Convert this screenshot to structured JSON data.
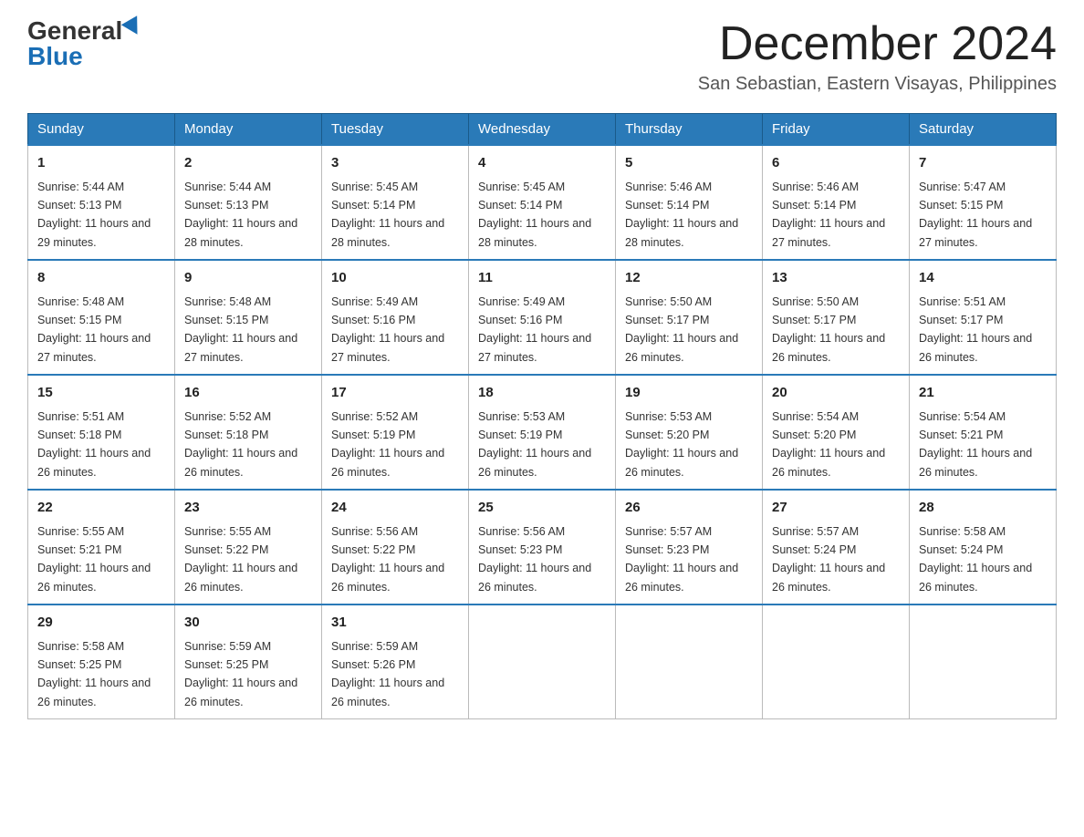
{
  "logo": {
    "general": "General",
    "blue": "Blue"
  },
  "title": {
    "month_year": "December 2024",
    "location": "San Sebastian, Eastern Visayas, Philippines"
  },
  "weekdays": [
    "Sunday",
    "Monday",
    "Tuesday",
    "Wednesday",
    "Thursday",
    "Friday",
    "Saturday"
  ],
  "weeks": [
    [
      {
        "day": "1",
        "sunrise": "5:44 AM",
        "sunset": "5:13 PM",
        "daylight": "11 hours and 29 minutes."
      },
      {
        "day": "2",
        "sunrise": "5:44 AM",
        "sunset": "5:13 PM",
        "daylight": "11 hours and 28 minutes."
      },
      {
        "day": "3",
        "sunrise": "5:45 AM",
        "sunset": "5:14 PM",
        "daylight": "11 hours and 28 minutes."
      },
      {
        "day": "4",
        "sunrise": "5:45 AM",
        "sunset": "5:14 PM",
        "daylight": "11 hours and 28 minutes."
      },
      {
        "day": "5",
        "sunrise": "5:46 AM",
        "sunset": "5:14 PM",
        "daylight": "11 hours and 28 minutes."
      },
      {
        "day": "6",
        "sunrise": "5:46 AM",
        "sunset": "5:14 PM",
        "daylight": "11 hours and 27 minutes."
      },
      {
        "day": "7",
        "sunrise": "5:47 AM",
        "sunset": "5:15 PM",
        "daylight": "11 hours and 27 minutes."
      }
    ],
    [
      {
        "day": "8",
        "sunrise": "5:48 AM",
        "sunset": "5:15 PM",
        "daylight": "11 hours and 27 minutes."
      },
      {
        "day": "9",
        "sunrise": "5:48 AM",
        "sunset": "5:15 PM",
        "daylight": "11 hours and 27 minutes."
      },
      {
        "day": "10",
        "sunrise": "5:49 AM",
        "sunset": "5:16 PM",
        "daylight": "11 hours and 27 minutes."
      },
      {
        "day": "11",
        "sunrise": "5:49 AM",
        "sunset": "5:16 PM",
        "daylight": "11 hours and 27 minutes."
      },
      {
        "day": "12",
        "sunrise": "5:50 AM",
        "sunset": "5:17 PM",
        "daylight": "11 hours and 26 minutes."
      },
      {
        "day": "13",
        "sunrise": "5:50 AM",
        "sunset": "5:17 PM",
        "daylight": "11 hours and 26 minutes."
      },
      {
        "day": "14",
        "sunrise": "5:51 AM",
        "sunset": "5:17 PM",
        "daylight": "11 hours and 26 minutes."
      }
    ],
    [
      {
        "day": "15",
        "sunrise": "5:51 AM",
        "sunset": "5:18 PM",
        "daylight": "11 hours and 26 minutes."
      },
      {
        "day": "16",
        "sunrise": "5:52 AM",
        "sunset": "5:18 PM",
        "daylight": "11 hours and 26 minutes."
      },
      {
        "day": "17",
        "sunrise": "5:52 AM",
        "sunset": "5:19 PM",
        "daylight": "11 hours and 26 minutes."
      },
      {
        "day": "18",
        "sunrise": "5:53 AM",
        "sunset": "5:19 PM",
        "daylight": "11 hours and 26 minutes."
      },
      {
        "day": "19",
        "sunrise": "5:53 AM",
        "sunset": "5:20 PM",
        "daylight": "11 hours and 26 minutes."
      },
      {
        "day": "20",
        "sunrise": "5:54 AM",
        "sunset": "5:20 PM",
        "daylight": "11 hours and 26 minutes."
      },
      {
        "day": "21",
        "sunrise": "5:54 AM",
        "sunset": "5:21 PM",
        "daylight": "11 hours and 26 minutes."
      }
    ],
    [
      {
        "day": "22",
        "sunrise": "5:55 AM",
        "sunset": "5:21 PM",
        "daylight": "11 hours and 26 minutes."
      },
      {
        "day": "23",
        "sunrise": "5:55 AM",
        "sunset": "5:22 PM",
        "daylight": "11 hours and 26 minutes."
      },
      {
        "day": "24",
        "sunrise": "5:56 AM",
        "sunset": "5:22 PM",
        "daylight": "11 hours and 26 minutes."
      },
      {
        "day": "25",
        "sunrise": "5:56 AM",
        "sunset": "5:23 PM",
        "daylight": "11 hours and 26 minutes."
      },
      {
        "day": "26",
        "sunrise": "5:57 AM",
        "sunset": "5:23 PM",
        "daylight": "11 hours and 26 minutes."
      },
      {
        "day": "27",
        "sunrise": "5:57 AM",
        "sunset": "5:24 PM",
        "daylight": "11 hours and 26 minutes."
      },
      {
        "day": "28",
        "sunrise": "5:58 AM",
        "sunset": "5:24 PM",
        "daylight": "11 hours and 26 minutes."
      }
    ],
    [
      {
        "day": "29",
        "sunrise": "5:58 AM",
        "sunset": "5:25 PM",
        "daylight": "11 hours and 26 minutes."
      },
      {
        "day": "30",
        "sunrise": "5:59 AM",
        "sunset": "5:25 PM",
        "daylight": "11 hours and 26 minutes."
      },
      {
        "day": "31",
        "sunrise": "5:59 AM",
        "sunset": "5:26 PM",
        "daylight": "11 hours and 26 minutes."
      },
      null,
      null,
      null,
      null
    ]
  ]
}
